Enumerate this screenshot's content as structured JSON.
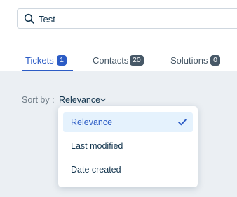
{
  "search": {
    "value": "Test",
    "icon": "search-icon"
  },
  "tabs": [
    {
      "label": "Tickets",
      "count": "1",
      "active": true
    },
    {
      "label": "Contacts",
      "count": "20",
      "active": false
    },
    {
      "label": "Solutions",
      "count": "0",
      "active": false
    }
  ],
  "sort": {
    "label": "Sort by :",
    "value": "Relevance",
    "options": [
      {
        "label": "Relevance",
        "selected": true
      },
      {
        "label": "Last modified",
        "selected": false
      },
      {
        "label": "Date created",
        "selected": false
      }
    ]
  },
  "colors": {
    "accent": "#2c5cc5",
    "badge_inactive": "#475867",
    "content_bg": "#ebeff3",
    "selected_option_bg": "#e5f2fd"
  }
}
